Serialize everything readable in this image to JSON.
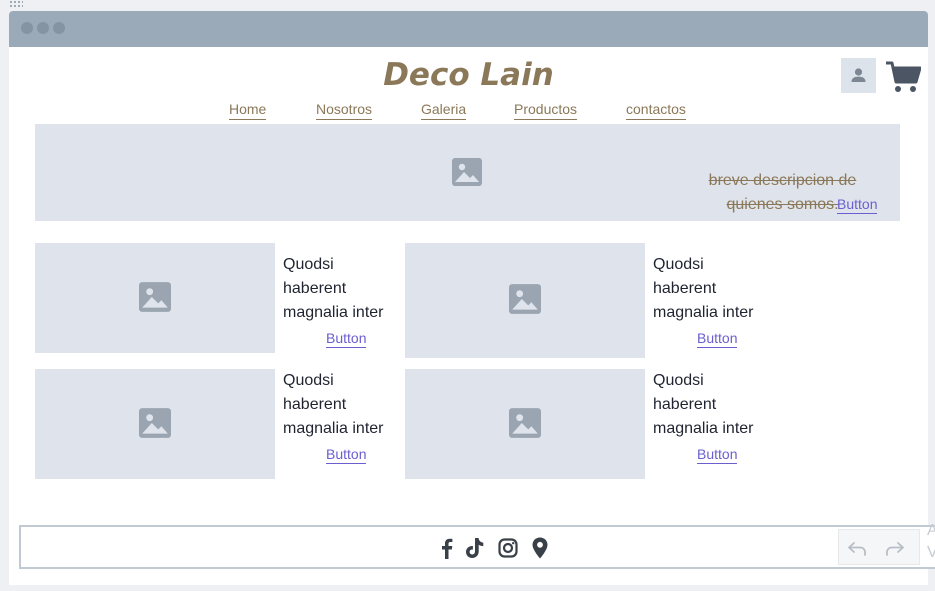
{
  "site": {
    "brand": "Deco Lain",
    "nav": [
      {
        "label": "Home"
      },
      {
        "label": "Nosotros"
      },
      {
        "label": "Galeria"
      },
      {
        "label": "Productos"
      },
      {
        "label": "contactos"
      }
    ]
  },
  "hero": {
    "text": "breve descripcion de quienes somos.",
    "button_label": "Button"
  },
  "cards": [
    {
      "text": "Quodsi haberent magnalia inter",
      "button_label": "Button"
    },
    {
      "text": "Quodsi haberent magnalia inter",
      "button_label": "Button"
    },
    {
      "text": "Quodsi haberent magnalia inter",
      "button_label": "Button"
    },
    {
      "text": "Quodsi haberent magnalia inter",
      "button_label": "Button"
    }
  ],
  "footer": {
    "social_icons": [
      "facebook-icon",
      "tiktok-icon",
      "instagram-icon",
      "location-pin-icon"
    ]
  },
  "edge_text": "A V",
  "colors": {
    "brand": "#8a7858",
    "link": "#6b5fcf",
    "placeholder_bg": "#dfe4ec",
    "titlebar": "#9aaab9",
    "icon_gray": "#4b5563"
  }
}
